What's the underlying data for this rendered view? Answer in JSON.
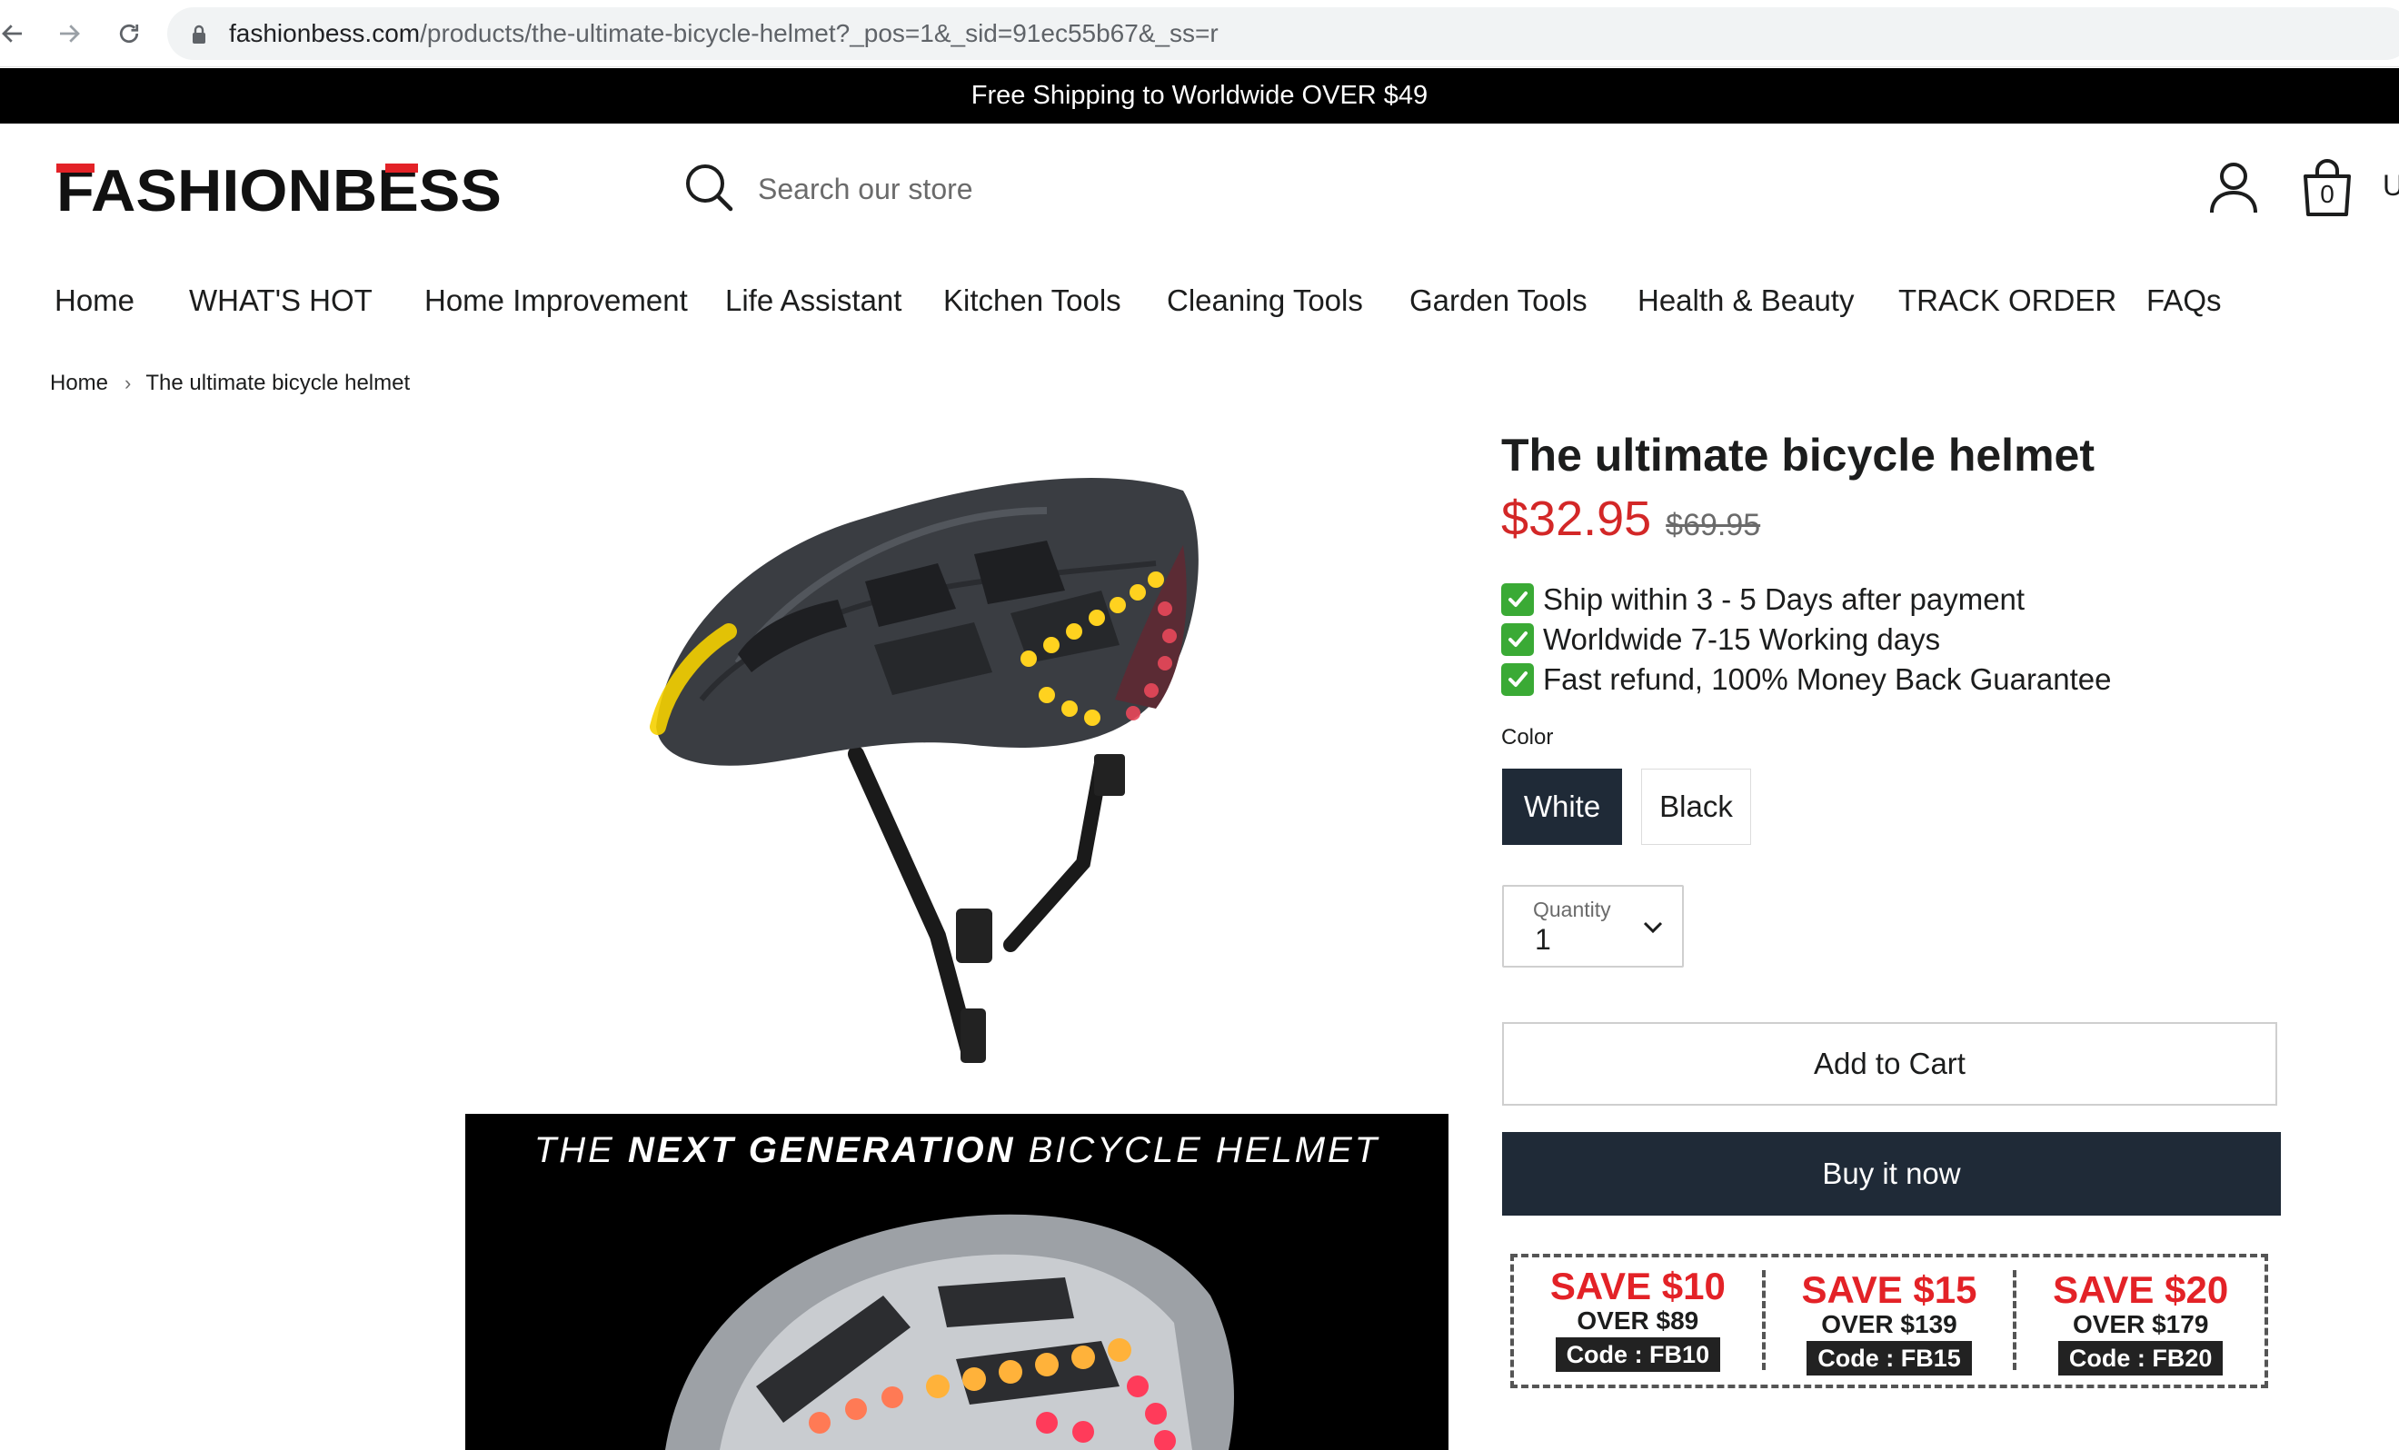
{
  "browser": {
    "url_host": "fashionbess.com",
    "url_path": "/products/the-ultimate-bicycle-helmet?_pos=1&_sid=91ec55b67&_ss=r"
  },
  "announcement": "Free Shipping to Worldwide OVER $49",
  "header": {
    "logo_text": "FASHIONBESS",
    "search_placeholder": "Search our store",
    "cart_count": "0",
    "edge_text": "U"
  },
  "nav": [
    {
      "label": "Home"
    },
    {
      "label": "WHAT'S HOT"
    },
    {
      "label": "Home Improvement"
    },
    {
      "label": "Life Assistant"
    },
    {
      "label": "Kitchen Tools"
    },
    {
      "label": "Cleaning Tools"
    },
    {
      "label": "Garden Tools"
    },
    {
      "label": "Health & Beauty"
    },
    {
      "label": "TRACK ORDER"
    },
    {
      "label": "FAQs"
    }
  ],
  "breadcrumb": {
    "home": "Home",
    "current": "The ultimate bicycle helmet"
  },
  "banner": {
    "prefix": "THE ",
    "bold": "NEXT GENERATION",
    "suffix": " BICYCLE HELMET"
  },
  "product": {
    "title": "The ultimate bicycle helmet",
    "price": "$32.95",
    "compare_price": "$69.95",
    "benefits": [
      "Ship within 3 - 5 Days after payment",
      "Worldwide 7-15 Working days",
      "Fast refund, 100% Money Back Guarantee"
    ],
    "color_label": "Color",
    "colors": [
      "White",
      "Black"
    ],
    "selected_color": "White",
    "quantity_label": "Quantity",
    "quantity": "1",
    "add_to_cart": "Add to Cart",
    "buy_now": "Buy it now"
  },
  "coupons": [
    {
      "save": "SAVE $10",
      "over": "OVER $89",
      "code": "Code : FB10"
    },
    {
      "save": "SAVE $15",
      "over": "OVER $139",
      "code": "Code : FB15"
    },
    {
      "save": "SAVE $20",
      "over": "OVER $179",
      "code": "Code : FB20"
    }
  ],
  "colors": {
    "sale_price": "#d32727",
    "dark_button": "#1f2a37",
    "coupon_red": "#e32227",
    "check_green": "#3aaa35"
  }
}
